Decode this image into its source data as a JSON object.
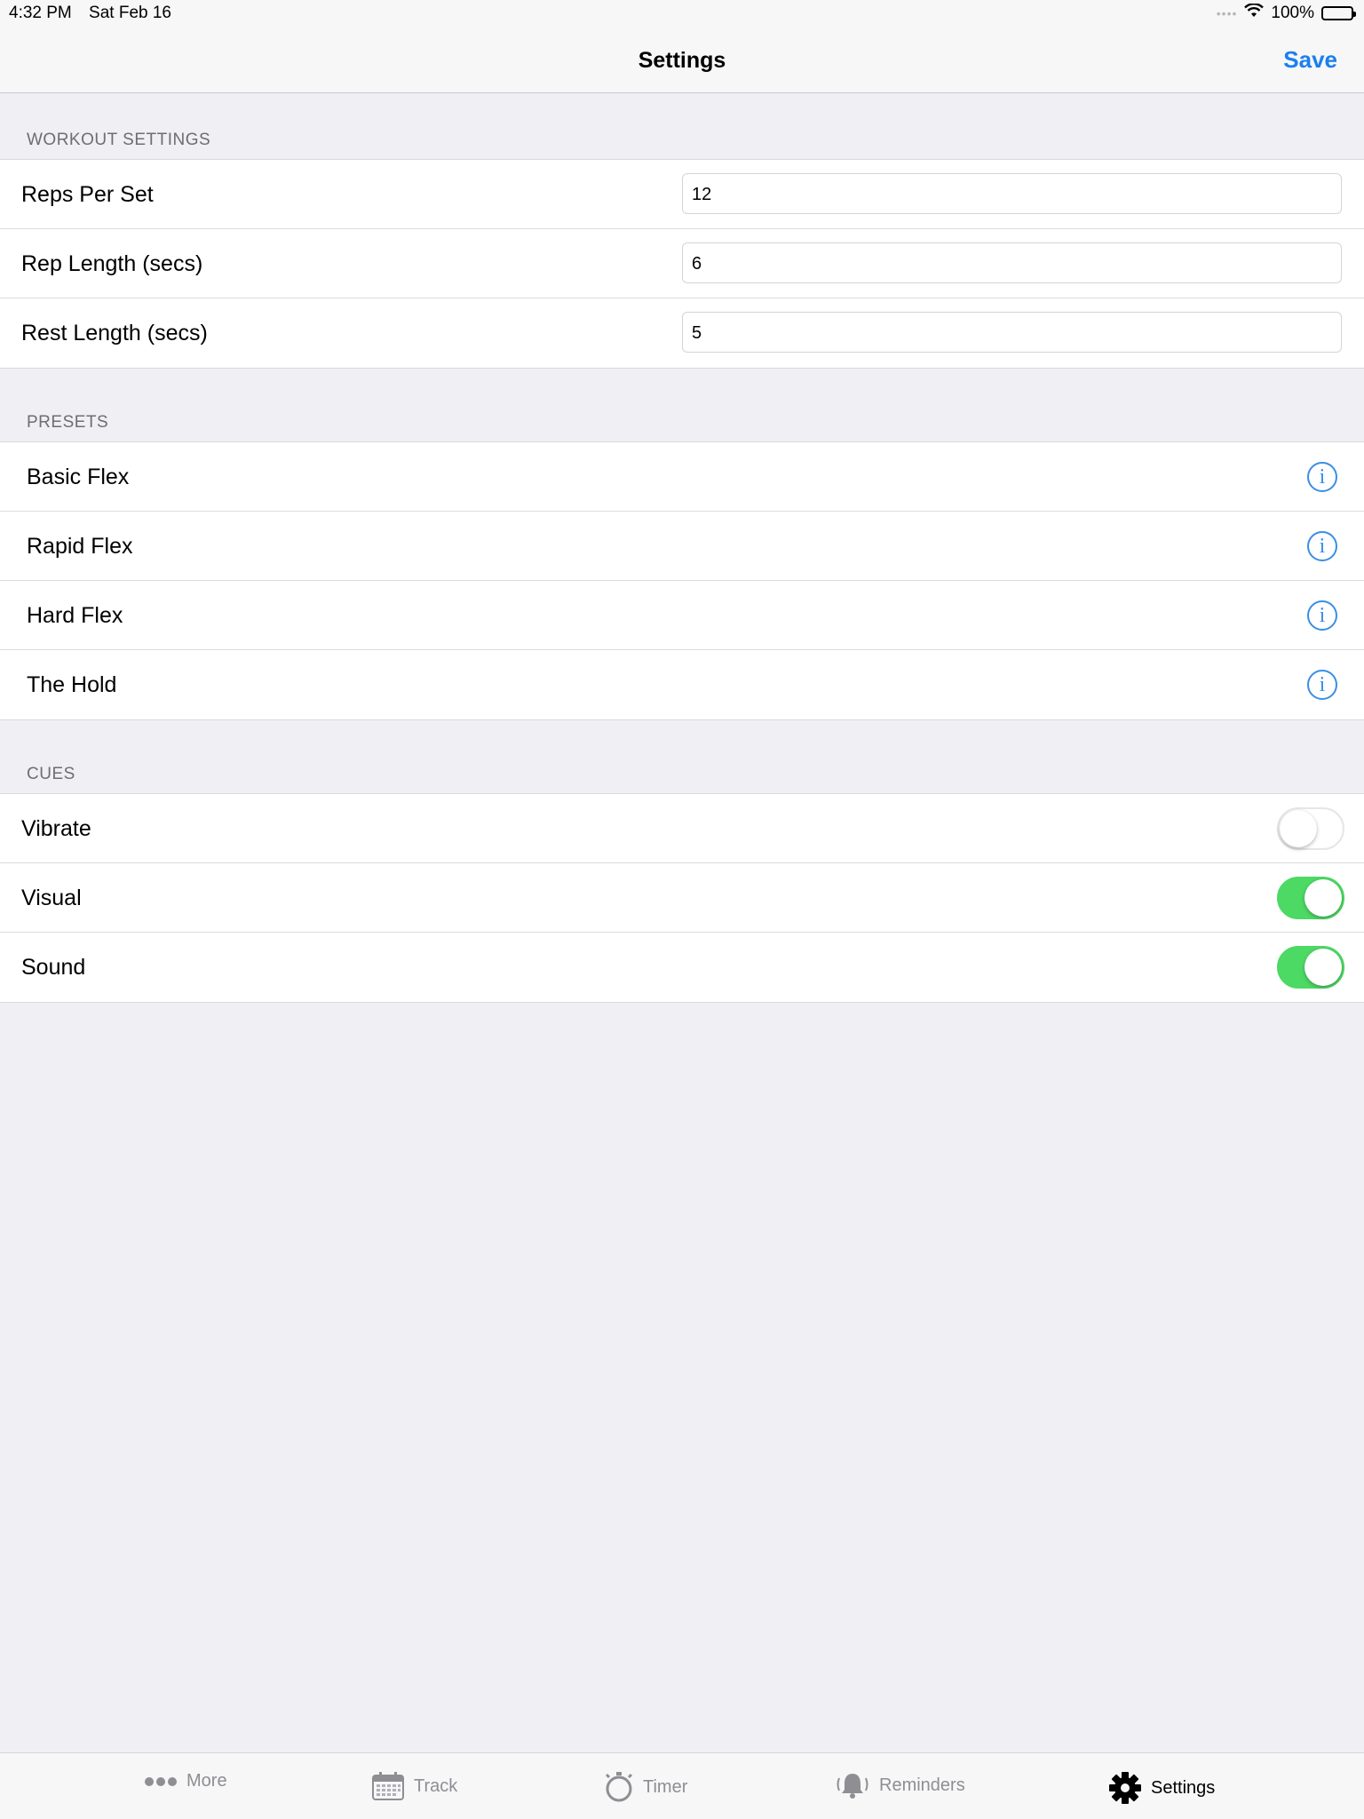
{
  "status_bar": {
    "time": "4:32 PM",
    "date": "Sat Feb 16",
    "battery": "100%"
  },
  "nav": {
    "title": "Settings",
    "save_label": "Save"
  },
  "workout_settings": {
    "header": "WORKOUT SETTINGS",
    "rows": [
      {
        "label": "Reps Per Set",
        "value": "12"
      },
      {
        "label": "Rep Length (secs)",
        "value": "6"
      },
      {
        "label": "Rest Length (secs)",
        "value": "5"
      }
    ]
  },
  "presets": {
    "header": "PRESETS",
    "items": [
      {
        "label": "Basic Flex",
        "icon": "info-icon"
      },
      {
        "label": "Rapid Flex",
        "icon": "info-icon"
      },
      {
        "label": "Hard Flex",
        "icon": "info-icon"
      },
      {
        "label": "The Hold",
        "icon": "info-icon"
      }
    ]
  },
  "cues": {
    "header": "CUES",
    "items": [
      {
        "label": "Vibrate",
        "enabled": false
      },
      {
        "label": "Visual",
        "enabled": true
      },
      {
        "label": "Sound",
        "enabled": true
      }
    ]
  },
  "tab_bar": {
    "active": "Settings",
    "tabs": [
      {
        "label": "More",
        "icon": "more-icon"
      },
      {
        "label": "Track",
        "icon": "calendar-icon"
      },
      {
        "label": "Timer",
        "icon": "stopwatch-icon"
      },
      {
        "label": "Reminders",
        "icon": "bell-icon"
      },
      {
        "label": "Settings",
        "icon": "gear-icon"
      }
    ]
  },
  "colors": {
    "accent": "#1a7ff0",
    "toggle_on": "#4cd964",
    "background": "#efeff4"
  }
}
